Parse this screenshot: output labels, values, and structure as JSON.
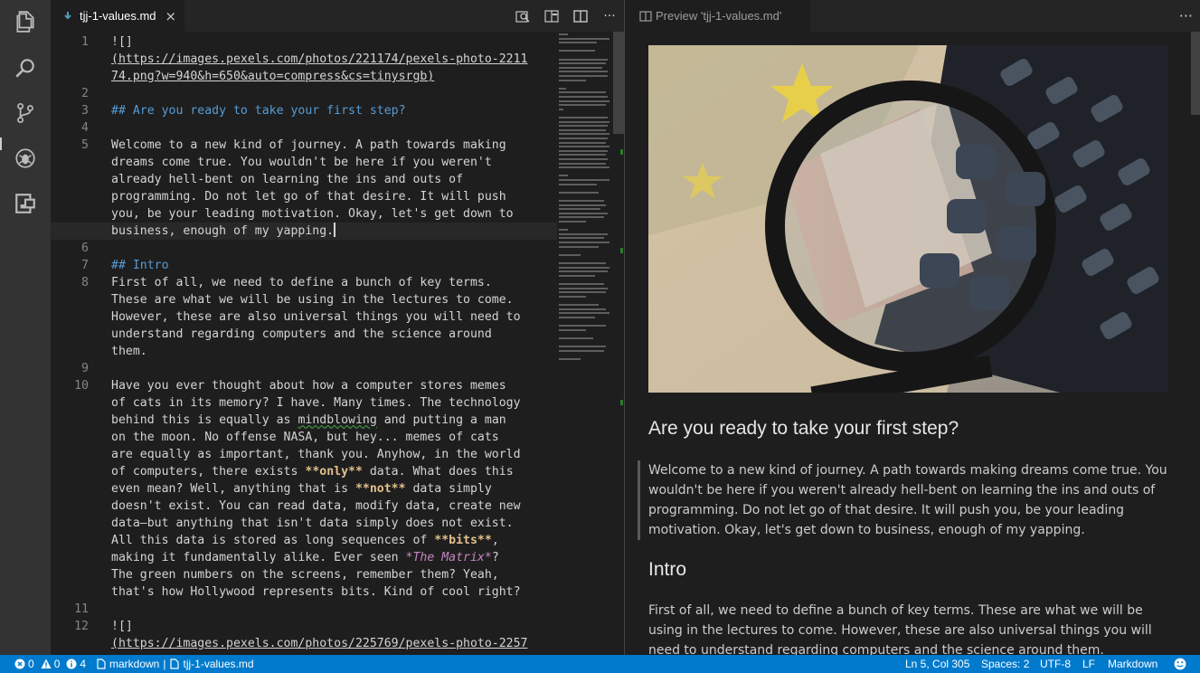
{
  "activity_bar": {
    "items": [
      {
        "icon": "explorer-icon"
      },
      {
        "icon": "search-icon"
      },
      {
        "icon": "source-control-icon"
      },
      {
        "icon": "debug-icon"
      },
      {
        "icon": "extensions-icon"
      }
    ]
  },
  "editor": {
    "tab_label": "tjj-1-values.md",
    "tab_close": "×",
    "more": "···",
    "lines": [
      {
        "num": "1",
        "text": "![]"
      },
      {
        "num": "",
        "text": "(https://images.pexels.com/photos/221174/pexels-photo-2211"
      },
      {
        "num": "",
        "text": "74.png?w=940&h=650&auto=compress&cs=tinysrgb)"
      },
      {
        "num": "2",
        "text": ""
      },
      {
        "num": "3",
        "text": "## Are you ready to take your first step?"
      },
      {
        "num": "4",
        "text": ""
      },
      {
        "num": "5",
        "text": "Welcome to a new kind of journey. A path towards making"
      },
      {
        "num": "",
        "text": "dreams come true. You wouldn't be here if you weren't"
      },
      {
        "num": "",
        "text": "already hell-bent on learning the ins and outs of"
      },
      {
        "num": "",
        "text": "programming. Do not let go of that desire. It will push"
      },
      {
        "num": "",
        "text": "you, be your leading motivation. Okay, let's get down to"
      },
      {
        "num": "",
        "text": "business, enough of my yapping."
      },
      {
        "num": "6",
        "text": ""
      },
      {
        "num": "7",
        "text": "## Intro"
      },
      {
        "num": "8",
        "text": "First of all, we need to define a bunch of key terms."
      },
      {
        "num": "",
        "text": "These are what we will be using in the lectures to come."
      },
      {
        "num": "",
        "text": "However, these are also universal things you will need to"
      },
      {
        "num": "",
        "text": "understand regarding computers and the science around"
      },
      {
        "num": "",
        "text": "them."
      },
      {
        "num": "9",
        "text": ""
      },
      {
        "num": "10",
        "text": "Have you ever thought about how a computer stores memes"
      },
      {
        "num": "",
        "text": "of cats in its memory? I have. Many times. The technology"
      },
      {
        "num": "",
        "text_a": "behind this is equally as ",
        "text_sq": "mindblowing",
        "text_b": " and putting a man"
      },
      {
        "num": "",
        "text": "on the moon. No offense NASA, but hey... memes of cats"
      },
      {
        "num": "",
        "text": "are equally as important, thank you. Anyhow, in the world"
      },
      {
        "num": "",
        "text_a": "of computers, there exists ",
        "text_bold": "**only**",
        "text_b": " data. What does this"
      },
      {
        "num": "",
        "text_a": "even mean? Well, anything that is ",
        "text_bold": "**not**",
        "text_b": " data simply"
      },
      {
        "num": "",
        "text": "doesn't exist. You can read data, modify data, create new"
      },
      {
        "num": "",
        "text": "data—but anything that isn't data simply does not exist."
      },
      {
        "num": "",
        "text_a": "All this data is stored as long sequences of ",
        "text_bold": "**bits**",
        "text_b": ","
      },
      {
        "num": "",
        "text_a": "making it fundamentally alike. Ever seen ",
        "text_em": "*The Matrix*",
        "text_b": "?"
      },
      {
        "num": "",
        "text": "The green numbers on the screens, remember them? Yeah,"
      },
      {
        "num": "",
        "text": "that's how Hollywood represents bits. Kind of cool right?"
      },
      {
        "num": "11",
        "text": ""
      },
      {
        "num": "12",
        "text": "![]"
      },
      {
        "num": "",
        "text": "(https://images.pexels.com/photos/225769/pexels-photo-2257"
      }
    ]
  },
  "preview": {
    "tab_label": "Preview 'tjj-1-values.md'",
    "more": "···",
    "heading1": "Are you ready to take your first step?",
    "quote": "Welcome to a new kind of journey. A path towards making dreams come true. You wouldn't be here if you weren't already hell-bent on learning the ins and outs of programming. Do not let go of that desire. It will push you, be your leading motivation. Okay, let's get down to business, enough of my yapping.",
    "heading2": "Intro",
    "body": "First of all, we need to define a bunch of key terms. These are what we will be using in the lectures to come. However, these are also universal things you will need to understand regarding computers and the science around them."
  },
  "status": {
    "errors": "0",
    "warnings": "0",
    "infos": "4",
    "mode_left": "markdown",
    "file": "tjj-1-values.md",
    "position": "Ln 5, Col 305",
    "spaces": "Spaces: 2",
    "encoding": "UTF-8",
    "eol": "LF",
    "language": "Markdown"
  },
  "colors": {
    "status_bar": "#007acc",
    "activity_bar": "#333333",
    "editor_bg": "#1e1e1e",
    "heading": "#569cd6",
    "bold": "#e2c08d",
    "italic": "#c586c0"
  }
}
